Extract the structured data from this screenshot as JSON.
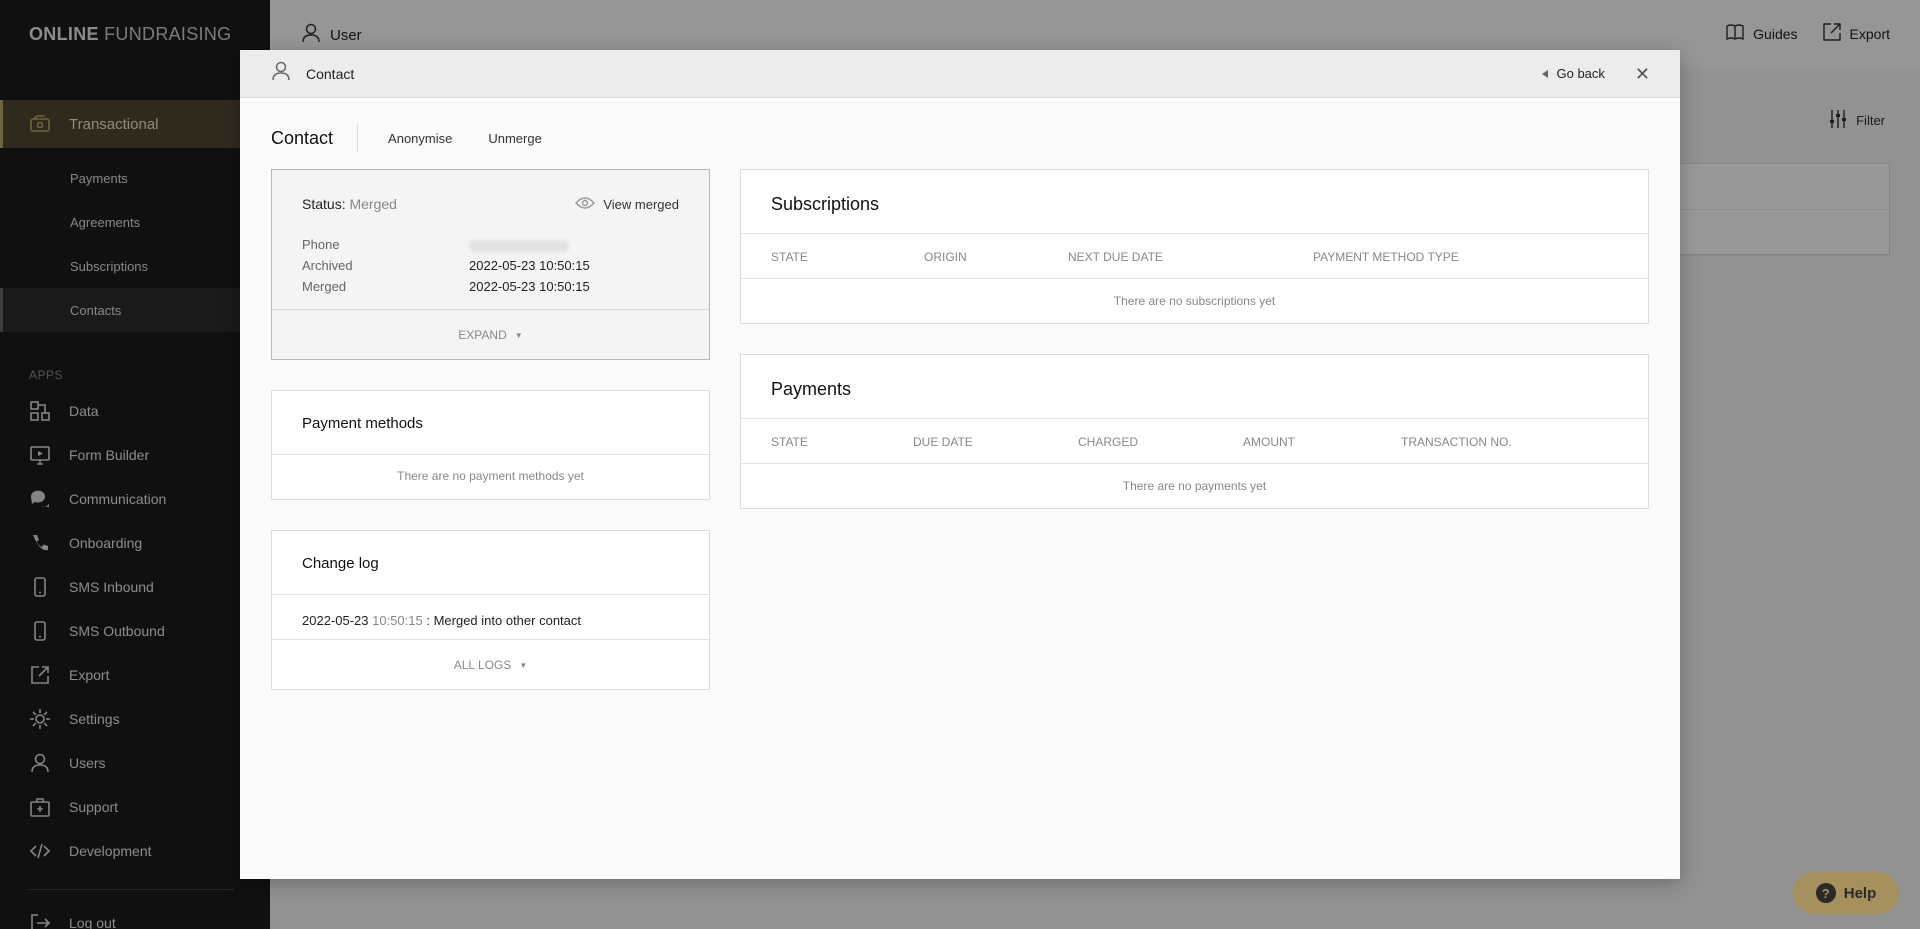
{
  "app": {
    "logo_bold": "ONLINE",
    "logo_light": "FUNDRAISING"
  },
  "sidebar": {
    "main": {
      "label": "Transactional",
      "icon": "wallet-icon"
    },
    "sub_items": [
      {
        "label": "Payments"
      },
      {
        "label": "Agreements"
      },
      {
        "label": "Subscriptions"
      },
      {
        "label": "Contacts",
        "active": true
      }
    ],
    "apps_label": "APPS",
    "apps": [
      {
        "label": "Data",
        "icon": "data-icon"
      },
      {
        "label": "Form Builder",
        "icon": "monitor-icon"
      },
      {
        "label": "Communication",
        "icon": "chat-icon"
      },
      {
        "label": "Onboarding",
        "icon": "phone-icon"
      },
      {
        "label": "SMS Inbound",
        "icon": "mobile-icon"
      },
      {
        "label": "SMS Outbound",
        "icon": "mobile-icon"
      },
      {
        "label": "Export",
        "icon": "export-icon"
      },
      {
        "label": "Settings",
        "icon": "gear-icon"
      },
      {
        "label": "Users",
        "icon": "user-icon"
      },
      {
        "label": "Support",
        "icon": "first-aid-icon"
      },
      {
        "label": "Development",
        "icon": "code-icon"
      }
    ],
    "logout": "Log out"
  },
  "topbar": {
    "user": "User",
    "guides": "Guides",
    "export": "Export",
    "filter": "Filter"
  },
  "help": {
    "label": "Help"
  },
  "modal": {
    "header_title": "Contact",
    "go_back": "Go back",
    "heading": "Contact",
    "actions": [
      "Anonymise",
      "Unmerge"
    ],
    "status": {
      "label": "Status:",
      "value": "Merged",
      "view_merged": "View merged",
      "fields": [
        {
          "key": "Phone",
          "value": ""
        },
        {
          "key": "Archived",
          "value": "2022-05-23 10:50:15"
        },
        {
          "key": "Merged",
          "value": "2022-05-23 10:50:15"
        }
      ],
      "expand": "EXPAND"
    },
    "payment_methods": {
      "title": "Payment methods",
      "empty": "There are no payment methods yet"
    },
    "change_log": {
      "title": "Change log",
      "entry_date": "2022-05-23",
      "entry_time": "10:50:15",
      "entry_text": ": Merged into other contact",
      "all_logs": "ALL LOGS"
    },
    "subscriptions": {
      "title": "Subscriptions",
      "columns": [
        "STATE",
        "ORIGIN",
        "NEXT DUE DATE",
        "PAYMENT METHOD TYPE"
      ],
      "empty": "There are no subscriptions yet"
    },
    "payments": {
      "title": "Payments",
      "columns": [
        "STATE",
        "DUE DATE",
        "CHARGED",
        "AMOUNT",
        "TRANSACTION NO."
      ],
      "empty": "There are no payments yet"
    }
  }
}
